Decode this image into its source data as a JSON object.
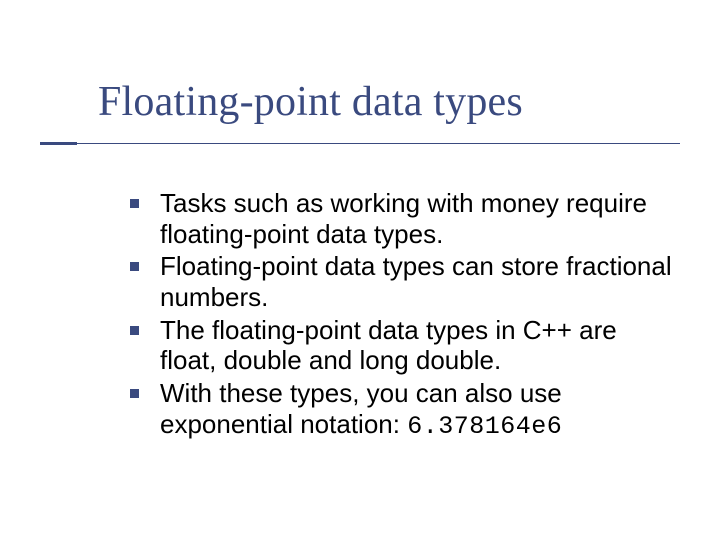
{
  "title": "Floating-point data types",
  "bullets": [
    {
      "text": "Tasks such as working with money require floating-point data types."
    },
    {
      "text": "Floating-point data types can store fractional numbers."
    },
    {
      "text": "The floating-point data types in C++ are float, double and long double."
    },
    {
      "text_prefix": "With these types, you can also use exponential notation: ",
      "code": "6.378164e6"
    }
  ]
}
